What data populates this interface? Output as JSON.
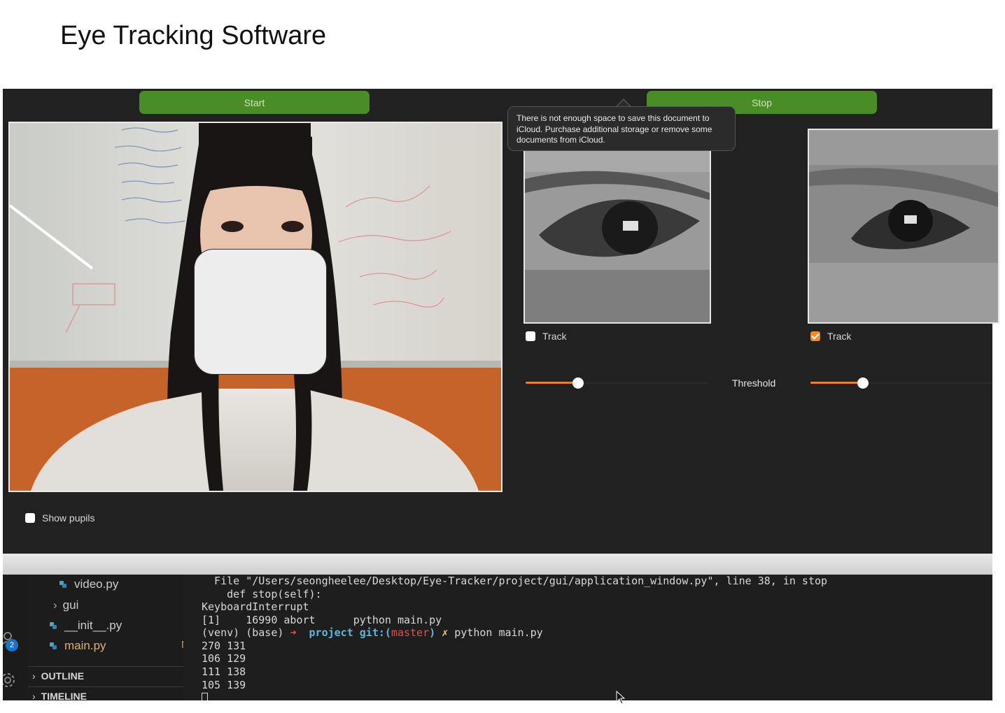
{
  "page": {
    "title": "Eye Tracking Software"
  },
  "app": {
    "start_label": "Start",
    "stop_label": "Stop",
    "tooltip": "There is not enough space to save this document to iCloud. Purchase additional storage or remove some documents from iCloud.",
    "left_eye": {
      "track_label": "Track",
      "track_checked": false,
      "threshold_fraction": 0.29
    },
    "right_eye": {
      "track_label": "Track",
      "track_checked": true,
      "threshold_fraction": 0.29
    },
    "threshold_label": "Threshold",
    "show_pupils_label": "Show pupils",
    "show_pupils_checked": false,
    "accent_color": "#f07d2a",
    "button_color": "#4a8d27"
  },
  "ide": {
    "explorer": {
      "items": [
        {
          "label": "video.py",
          "icon": "python-file-icon"
        },
        {
          "label": "gui",
          "icon": "chevron-right-icon"
        },
        {
          "label": "__init__.py",
          "icon": "python-file-icon"
        },
        {
          "label": "main.py",
          "icon": "python-file-icon",
          "badge": "M"
        }
      ],
      "sections": [
        "OUTLINE",
        "TIMELINE"
      ]
    },
    "activity_badge": "2",
    "terminal": {
      "lines": [
        "  File \"/Users/seongheelee/Desktop/Eye-Tracker/project/gui/application_window.py\", line 38, in stop",
        "    def stop(self):",
        "KeyboardInterrupt",
        "[1]    16990 abort      python main.py",
        "270 131",
        "106 129",
        "111 138",
        "105 139"
      ],
      "prompt": {
        "env": "(venv) (base)",
        "arrow": "➜",
        "dir": "project",
        "git_label": "git:(",
        "branch": "master",
        "git_close": ")",
        "dirty": "✗",
        "command": "python main.py"
      }
    }
  }
}
